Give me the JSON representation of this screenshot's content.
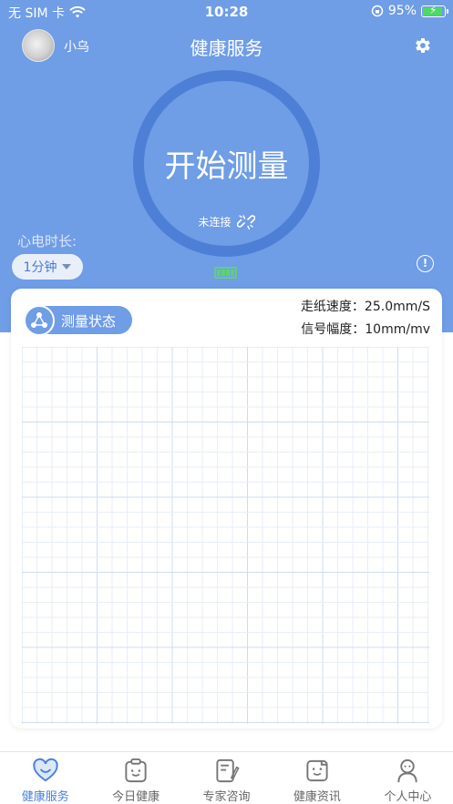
{
  "status_bar": {
    "carrier": "无 SIM 卡",
    "time": "10:28",
    "battery": "95%"
  },
  "header": {
    "username": "小乌",
    "title": "健康服务"
  },
  "measure": {
    "start_label": "开始测量",
    "connection_status": "未连接"
  },
  "duration": {
    "label": "心电时长:",
    "selected": "1分钟"
  },
  "card": {
    "state_label": "测量状态",
    "paper_speed": "走纸速度：25.0mm/S",
    "signal_amplitude": "信号幅度：10mm/mv"
  },
  "tabs": [
    {
      "label": "健康服务",
      "icon": "heart-icon",
      "active": true
    },
    {
      "label": "今日健康",
      "icon": "clipboard-face-icon",
      "active": false
    },
    {
      "label": "专家咨询",
      "icon": "document-pen-icon",
      "active": false
    },
    {
      "label": "健康资讯",
      "icon": "news-face-icon",
      "active": false
    },
    {
      "label": "个人中心",
      "icon": "person-icon",
      "active": false
    }
  ],
  "colors": {
    "primary": "#6f9de6",
    "ring": "#4d7fd6",
    "active_tab": "#4a80db",
    "battery_green": "#5ed178"
  }
}
